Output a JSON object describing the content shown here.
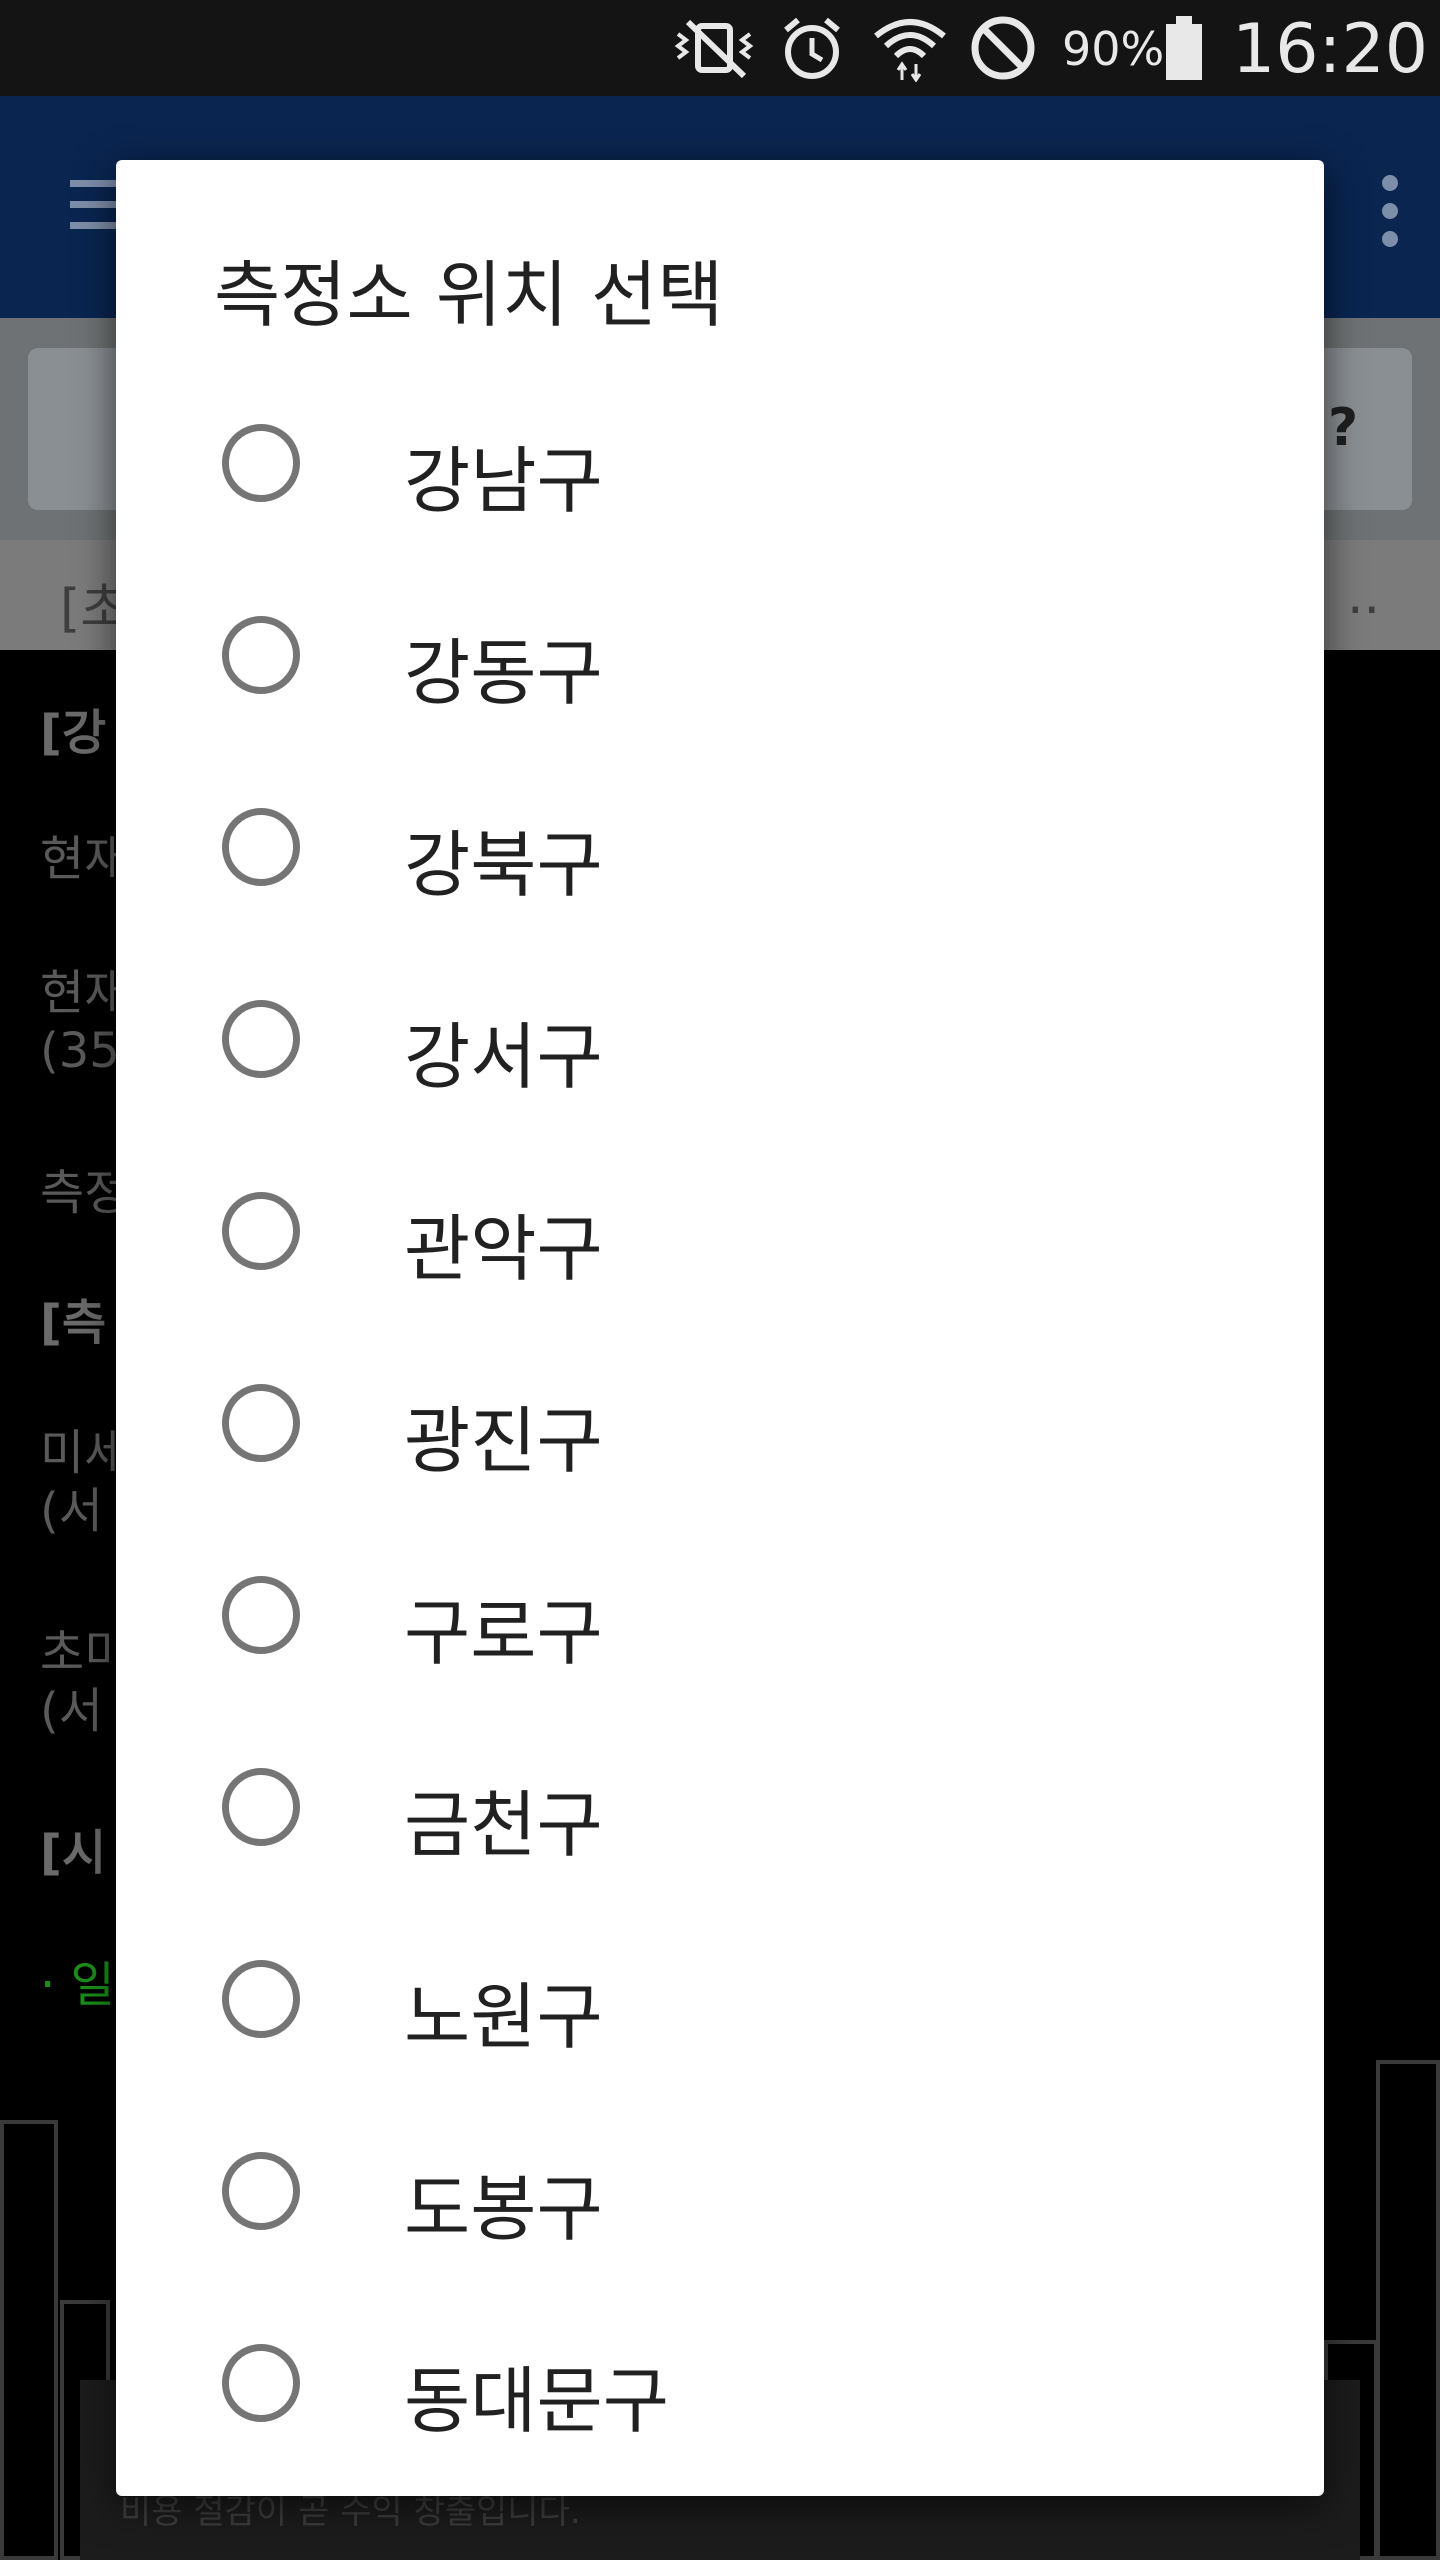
{
  "status_bar": {
    "battery": "90%",
    "time": "16:20",
    "icons": [
      "mute-vibrate-icon",
      "alarm-icon",
      "wifi-icon",
      "do-not-disturb-icon",
      "battery-icon"
    ]
  },
  "background_app": {
    "help_label": "?",
    "strip_left": "[초",
    "strip_right": "..",
    "lines": [
      "[강",
      "현재",
      "현재\n(35",
      "측정",
      "[측",
      "미세\n(서",
      "초미\n(서",
      "[시",
      "· 일"
    ],
    "ad_text": "비용 절감이 곧 수익 창출입니다."
  },
  "dialog": {
    "title": "측정소 위치 선택",
    "options": [
      {
        "label": "강남구",
        "selected": false
      },
      {
        "label": "강동구",
        "selected": false
      },
      {
        "label": "강북구",
        "selected": false
      },
      {
        "label": "강서구",
        "selected": false
      },
      {
        "label": "관악구",
        "selected": false
      },
      {
        "label": "광진구",
        "selected": false
      },
      {
        "label": "구로구",
        "selected": false
      },
      {
        "label": "금천구",
        "selected": false
      },
      {
        "label": "노원구",
        "selected": false
      },
      {
        "label": "도봉구",
        "selected": false
      },
      {
        "label": "동대문구",
        "selected": false
      }
    ]
  },
  "colors": {
    "dialog_bg": "#ffffff",
    "radio_border": "#757575",
    "text": "#212121",
    "appbar": "#0a2550"
  }
}
